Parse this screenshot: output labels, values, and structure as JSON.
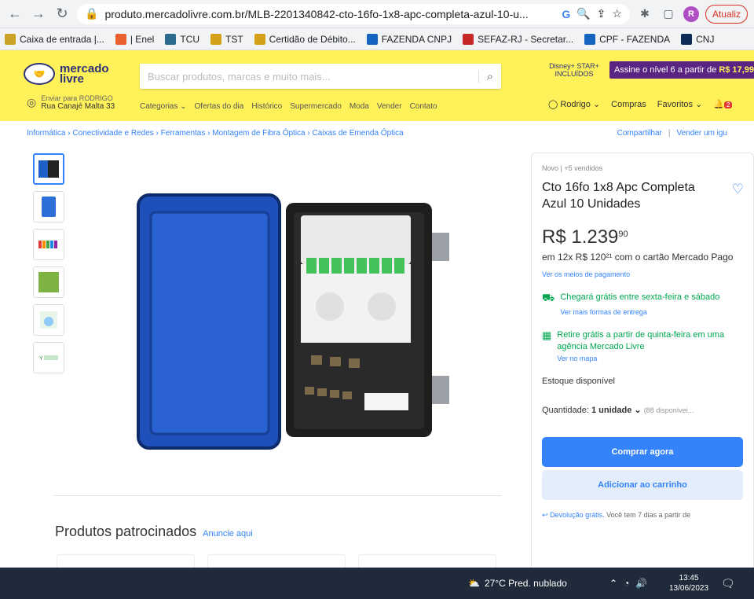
{
  "browser": {
    "url": "produto.mercadolivre.com.br/MLB-2201340842-cto-16fo-1x8-apc-completa-azul-10-u...",
    "profile_initial": "R",
    "update_label": "Atualiz"
  },
  "bookmarks": [
    {
      "label": "Caixa de entrada |...",
      "color": "#c9a227"
    },
    {
      "label": "| Enel",
      "color": "#e8612c"
    },
    {
      "label": "TCU",
      "color": "#2e6a8e"
    },
    {
      "label": "TST",
      "color": "#d4a017"
    },
    {
      "label": "Certidão de Débito...",
      "color": "#d4a017"
    },
    {
      "label": "FAZENDA CNPJ",
      "color": "#1565c0"
    },
    {
      "label": "SEFAZ-RJ - Secretar...",
      "color": "#c62828"
    },
    {
      "label": "CPF - FAZENDA",
      "color": "#1565c0"
    },
    {
      "label": "CNJ",
      "color": "#0d2c55"
    }
  ],
  "header": {
    "logo_line1": "mercado",
    "logo_line2": "livre",
    "search_placeholder": "Buscar produtos, marcas e muito mais...",
    "promo_brand": "Disney+ STAR+ INCLUÍDOS",
    "promo_text": "Assine o nível 6 a partir de",
    "promo_price": "R$ 17,99",
    "address_line1": "Enviar para RODRIGO",
    "address_line2": "Rua Canajé Malta 33",
    "nav": [
      "Categorias ⌄",
      "Ofertas do dia",
      "Histórico",
      "Supermercado",
      "Moda",
      "Vender",
      "Contato"
    ],
    "user": "Rodrigo ⌄",
    "compras": "Compras",
    "favoritos": "Favoritos ⌄",
    "notif_count": "2"
  },
  "breadcrumbs": [
    "Informática",
    "Conectividade e Redes",
    "Ferramentas",
    "Montagem de Fibra Óptica",
    "Caixas de Emenda Óptica"
  ],
  "breadcrumb_actions": {
    "share": "Compartilhar",
    "sell": "Vender um igu"
  },
  "product": {
    "condition": "Novo | +5 vendidos",
    "title": "Cto 16fo 1x8 Apc Completa Azul 10 Unidades",
    "price_int": "R$ 1.239",
    "price_cents": "90",
    "installments": "em 12x R$ 120²¹ com o cartão Mercado Pago",
    "payment_link": "Ver os meios de pagamento",
    "shipping_text": "Chegará grátis entre sexta-feira e sábado",
    "shipping_link": "Ver mais formas de entrega",
    "pickup_text": "Retire grátis a partir de quinta-feira em uma agência Mercado Livre",
    "pickup_link": "Ver no mapa",
    "stock": "Estoque disponível",
    "qty_label": "Quantidade:",
    "qty_value": "1 unidade ⌄",
    "qty_available": "(88 disponívei...",
    "buy_now": "Comprar agora",
    "add_cart": "Adicionar ao carrinho",
    "returns_link": "Devolução grátis.",
    "returns_text": "Você tem 7 dias a partir de"
  },
  "sponsored": {
    "title": "Produtos patrocinados",
    "link": "Anuncie aqui"
  },
  "taskbar": {
    "weather": "27°C  Pred. nublado",
    "time": "13:45",
    "date": "13/06/2023"
  }
}
